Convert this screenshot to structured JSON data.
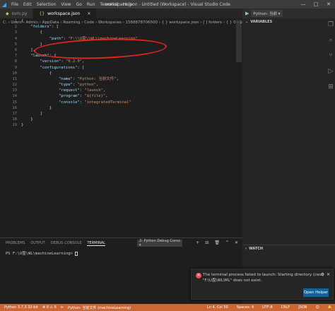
{
  "titlebar": {
    "menu": [
      "File",
      "Edit",
      "Selection",
      "View",
      "Go",
      "Run",
      "Terminal",
      "Help"
    ],
    "title": "workspace.json - Untitled (Workspace) - Visual Studio Code",
    "controls": [
      "—",
      "□",
      "✕"
    ]
  },
  "tabs": [
    {
      "label": "svm.py",
      "active": false
    },
    {
      "label": "workspace.json",
      "active": true
    }
  ],
  "breadcrumb": "C: › Users › Admin › AppData › Roaming › Code › Workspaces › 1568878706500 › { } workspace.json › [ ] folders › { } 0 › path",
  "code": {
    "line_numbers": [
      "1",
      "2",
      "3",
      "4",
      "5",
      "6",
      "7",
      "8",
      "9",
      "10",
      "11",
      "12",
      "13",
      "14",
      "15",
      "16",
      "17",
      "18",
      "19"
    ],
    "lines": [
      "{",
      "    \"folders\": [",
      "        {",
      "            \"path\": \"F:\\\\U盘\\\\WL\\\\machineLearning\"",
      "        }",
      "    ],",
      "    \"launch\": {",
      "        \"version\": \"0.2.0\",",
      "        \"configurations\": [",
      "            {",
      "                \"name\": \"Python: 当前文件\",",
      "                \"type\": \"python\",",
      "                \"request\": \"launch\",",
      "                \"program\": \"${file}\",",
      "                \"console\": \"integratedTerminal\"",
      "            }",
      "        ]",
      "    }",
      "}"
    ]
  },
  "run_panel": {
    "play_label": "▶",
    "config": "Python: 当前 ▾",
    "variables_label": "VARIABLES",
    "watch_label": "WATCH"
  },
  "panel": {
    "tabs": [
      "PROBLEMS",
      "OUTPUT",
      "DEBUG CONSOLE",
      "TERMINAL"
    ],
    "terminal_select": "2: Python Debug Consc ▾",
    "actions": [
      "+",
      "⊟",
      "🗑",
      "^",
      "✕"
    ],
    "terminal_line": "PS F:\\U盘\\WL\\machineLearning> "
  },
  "notification": {
    "text": "The terminal process failed to launch: Starting directory (cwd) \"F:\\U盘\\WL\\ML\" does not exist.",
    "button": "Open Helper",
    "gear": "⚙",
    "close": "✕"
  },
  "statusbar": {
    "left": [
      "Python 3.7.3 32-bit",
      "⊗ 0 ⚠ 0",
      "⊳",
      "Python: 当前文件 (machineLearning)"
    ],
    "right": [
      "Ln 4, Col 50",
      "Spaces: 4",
      "UTF-8",
      "CRLF",
      "JSON",
      "☺",
      "🔔"
    ]
  },
  "colors": {
    "statusbar": "#cc6633",
    "annotation": "#e0271f",
    "button": "#0e639c"
  }
}
